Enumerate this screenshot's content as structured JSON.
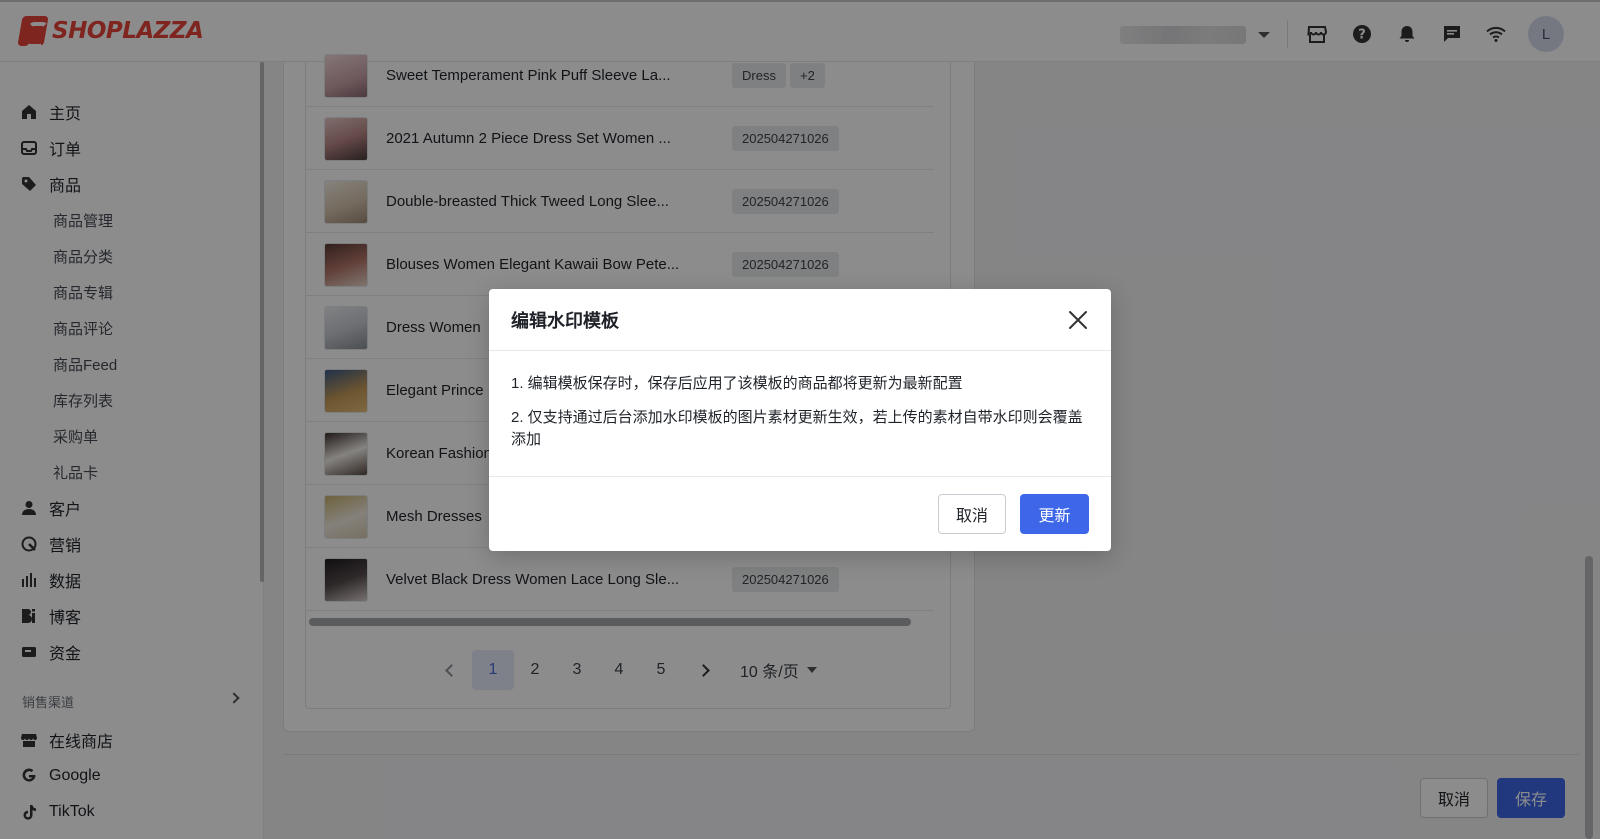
{
  "brand": {
    "logo_text": "SHOPLAZZA",
    "accent": "#e8443a",
    "primary": "#3d67e8"
  },
  "header": {
    "icons": [
      "store-icon",
      "help-icon",
      "bell-icon",
      "message-icon",
      "wifi-icon"
    ],
    "avatar_letter": "L"
  },
  "sidebar": {
    "items": [
      {
        "label": "主页",
        "icon": "home-icon"
      },
      {
        "label": "订单",
        "icon": "inbox-icon"
      },
      {
        "label": "商品",
        "icon": "tag-icon"
      }
    ],
    "product_sub": [
      "商品管理",
      "商品分类",
      "商品专辑",
      "商品评论",
      "商品Feed",
      "库存列表",
      "采购单",
      "礼品卡"
    ],
    "items2": [
      {
        "label": "客户",
        "icon": "user-icon"
      },
      {
        "label": "营销",
        "icon": "marketing-icon"
      },
      {
        "label": "数据",
        "icon": "chart-icon"
      },
      {
        "label": "博客",
        "icon": "blog-icon"
      },
      {
        "label": "资金",
        "icon": "wallet-icon"
      }
    ],
    "section_label": "销售渠道",
    "channels": [
      {
        "label": "在线商店",
        "icon": "store-icon"
      },
      {
        "label": "Google",
        "icon": "google-icon"
      },
      {
        "label": "TikTok",
        "icon": "tiktok-icon"
      }
    ]
  },
  "products": [
    {
      "title": "Sweet Temperament Pink Puff Sleeve La...",
      "tags": [
        "Dress",
        "+2"
      ]
    },
    {
      "title": "2021 Autumn 2 Piece Dress Set Women ...",
      "tags": [
        "202504271026"
      ]
    },
    {
      "title": "Double-breasted Thick Tweed Long Slee...",
      "tags": [
        "202504271026"
      ]
    },
    {
      "title": "Blouses Women Elegant Kawaii Bow Pete...",
      "tags": [
        "202504271026"
      ]
    },
    {
      "title": "Dress Women",
      "tags": []
    },
    {
      "title": "Elegant Prince",
      "tags": []
    },
    {
      "title": "Korean Fashion",
      "tags": []
    },
    {
      "title": "Mesh Dresses",
      "tags": []
    },
    {
      "title": "Velvet Black Dress Women Lace Long Sle...",
      "tags": [
        "202504271026"
      ]
    }
  ],
  "pagination": {
    "pages": [
      "1",
      "2",
      "3",
      "4",
      "5"
    ],
    "current": "1",
    "page_size": "10 条/页"
  },
  "footer": {
    "cancel": "取消",
    "save": "保存"
  },
  "modal": {
    "title": "编辑水印模板",
    "lines": [
      "1. 编辑模板保存时，保存后应用了该模板的商品都将更新为最新配置",
      "2. 仅支持通过后台添加水印模板的图片素材更新生效，若上传的素材自带水印则会覆盖添加"
    ],
    "cancel": "取消",
    "confirm": "更新"
  }
}
